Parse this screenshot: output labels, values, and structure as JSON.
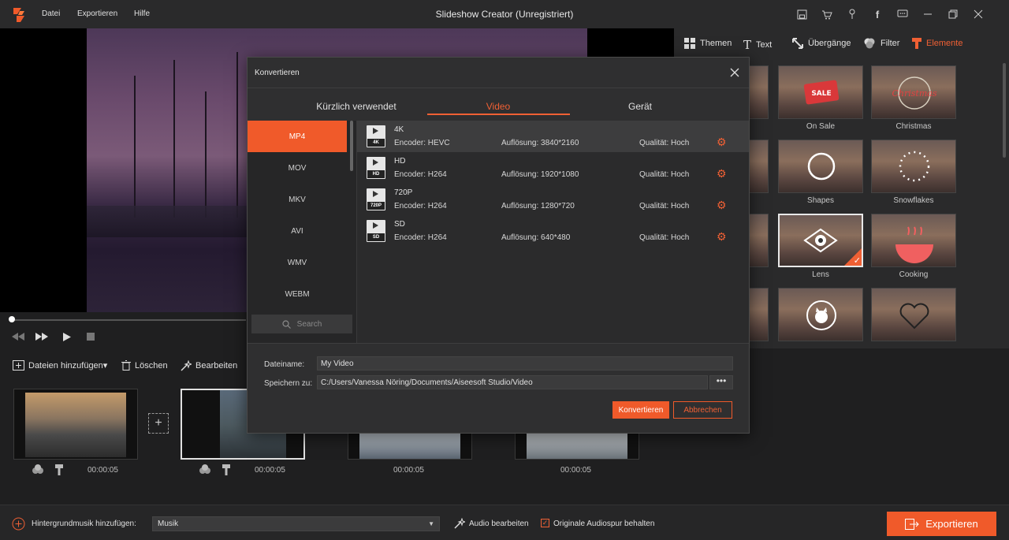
{
  "app": {
    "title": "Slideshow Creator (Unregistriert)",
    "menu": [
      "Datei",
      "Exportieren",
      "Hilfe"
    ]
  },
  "colors": {
    "accent": "#f05a2a",
    "bg": "#1f1f20",
    "panel": "#2a2a2b"
  },
  "right_panel": {
    "tabs": [
      {
        "label": "Themen",
        "icon": "grid-icon"
      },
      {
        "label": "Text",
        "icon": "text-icon"
      },
      {
        "label": "Übergänge",
        "icon": "transition-icon"
      },
      {
        "label": "Filter",
        "icon": "filter-icon"
      },
      {
        "label": "Elemente",
        "icon": "brush-icon",
        "active": true
      }
    ],
    "elements": [
      {
        "label": "On Sale"
      },
      {
        "label": "Christmas"
      },
      {
        "label": "Shapes"
      },
      {
        "label": "Snowflakes"
      },
      {
        "label": "Lens",
        "selected": true
      },
      {
        "label": "Cooking"
      },
      {
        "label": ""
      },
      {
        "label": ""
      }
    ]
  },
  "toolbar": {
    "add_files": "Dateien hinzufügen▾",
    "delete": "Löschen",
    "edit": "Bearbeiten"
  },
  "timeline": {
    "clips": [
      {
        "duration": "00:00:05"
      },
      {
        "duration": "00:00:05",
        "active": true
      },
      {
        "duration": "00:00:05"
      },
      {
        "duration": "00:00:05"
      }
    ]
  },
  "bottom": {
    "bg_music_label": "Hintergrundmusik hinzufügen:",
    "music_value": "Musik",
    "edit_audio": "Audio bearbeiten",
    "keep_audio": "Originale Audiospur behalten",
    "keep_audio_checked": true,
    "export": "Exportieren"
  },
  "dialog": {
    "title": "Konvertieren",
    "tabs": [
      {
        "label": "Kürzlich verwendet"
      },
      {
        "label": "Video",
        "active": true
      },
      {
        "label": "Gerät"
      }
    ],
    "formats": [
      "MP4",
      "MOV",
      "MKV",
      "AVI",
      "WMV",
      "WEBM"
    ],
    "selected_format": "MP4",
    "search_placeholder": "Search",
    "presets": [
      {
        "name": "4K",
        "badge": "4K",
        "encoder": "Encoder: HEVC",
        "resolution": "Auflösung: 3840*2160",
        "quality": "Qualität: Hoch"
      },
      {
        "name": "HD",
        "badge": "HD",
        "encoder": "Encoder: H264",
        "resolution": "Auflösung: 1920*1080",
        "quality": "Qualität: Hoch"
      },
      {
        "name": "720P",
        "badge": "720P",
        "encoder": "Encoder: H264",
        "resolution": "Auflösung: 1280*720",
        "quality": "Qualität: Hoch"
      },
      {
        "name": "SD",
        "badge": "SD",
        "encoder": "Encoder: H264",
        "resolution": "Auflösung: 640*480",
        "quality": "Qualität: Hoch"
      }
    ],
    "filename_label": "Dateiname:",
    "filename_value": "My Video",
    "save_label": "Speichern zu:",
    "save_path": "C:/Users/Vanessa Nöring/Documents/Aiseesoft Studio/Video",
    "browse": "•••",
    "convert": "Konvertieren",
    "cancel": "Abbrechen"
  }
}
